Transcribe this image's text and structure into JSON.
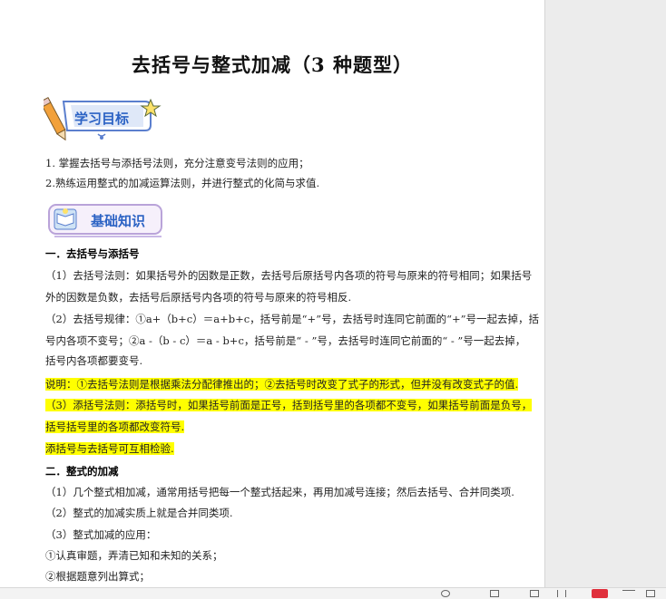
{
  "document": {
    "title": "去括号与整式加减（3 种题型）",
    "badges": {
      "goals": "学习目标",
      "basics": "基础知识"
    },
    "lines": {
      "g1": "1. 掌握去括号与添括号法则，充分注意变号法则的应用；",
      "g2": "2.熟练运用整式的加减运算法则，并进行整式的化简与求值.",
      "h1": "一．去括号与添括号",
      "p1a": "（1）去括号法则：如果括号外的因数是正数，去括号后原括号内各项的符号与原来的符号相同；如果括号",
      "p1b": "外的因数是负数，去括号后原括号内各项的符号与原来的符号相反.",
      "p2a": "（2）去括号规律：①a+（b+c）＝a+b+c，括号前是“+”号，去括号时连同它前面的“+”号一起去掉，括",
      "p2b": "号内各项不变号；②a -（b - c）＝a - b+c，括号前是“ - ”号，去括号时连同它前面的“ - ”号一起去掉，",
      "p2c": "括号内各项都要变号.",
      "n1": "说明：①去括号法则是根据乘法分配律推出的；②去括号时改变了式子的形式，但并没有改变式子的值.",
      "p3a": "（3）添括号法则：添括号时，如果括号前面是正号，括到括号里的各项都不变号，如果括号前面是负号，",
      "p3b": "括号括号里的各项都改变符号.",
      "n2": "添括号与去括号可互相检验.",
      "h2": "二．整式的加减",
      "q1": "（1）几个整式相加减，通常用括号把每一个整式括起来，再用加减号连接；然后去括号、合并同类项.",
      "q2": "（2）整式的加减实质上就是合并同类项.",
      "q3": "（3）整式加减的应用：",
      "s1": "①认真审题，弄清已知和未知的关系；",
      "s2": "②根据题意列出算式；"
    }
  },
  "colors": {
    "highlight": "#ffff00",
    "badge_blue": "#2b62c4",
    "badge_border": "#5b7fce",
    "pencil": "#f2a13b"
  }
}
